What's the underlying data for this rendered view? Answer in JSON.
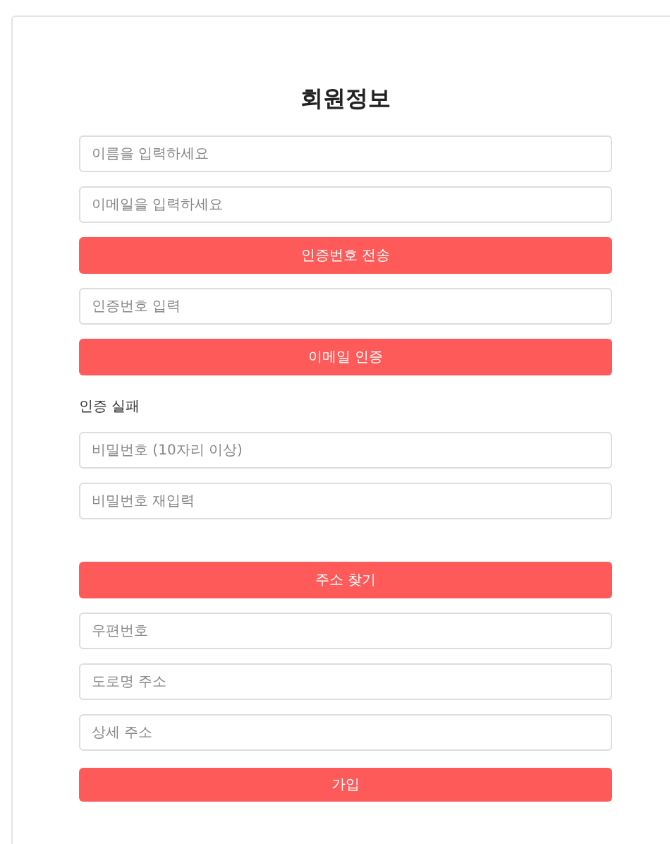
{
  "title": "회원정보",
  "sections": [
    {
      "items": [
        {
          "kind": "input",
          "placeholder": "이름을 입력하세요"
        },
        {
          "kind": "input",
          "placeholder": "이메일을 입력하세요"
        },
        {
          "kind": "button",
          "label": "인증번호 전송"
        },
        {
          "kind": "input",
          "placeholder": "인증번호 입력"
        },
        {
          "kind": "button",
          "label": "이메일 인증"
        },
        {
          "kind": "message",
          "text": "인증 실패"
        },
        {
          "kind": "input",
          "placeholder": "비밀번호 (10자리 이상)"
        },
        {
          "kind": "input",
          "placeholder": "비밀번호 재입력"
        }
      ]
    },
    {
      "items": [
        {
          "kind": "button",
          "label": "주소 찾기"
        },
        {
          "kind": "input",
          "placeholder": "우편번호"
        },
        {
          "kind": "input",
          "placeholder": "도로명 주소"
        },
        {
          "kind": "input",
          "placeholder": "상세 주소"
        },
        {
          "kind": "submit",
          "label": "가입"
        }
      ]
    }
  ]
}
